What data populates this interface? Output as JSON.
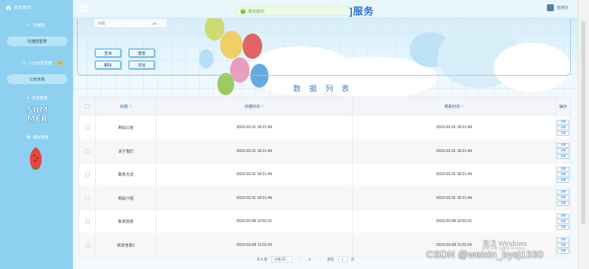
{
  "sidebar": {
    "home_label": "后台首页",
    "groups": [
      {
        "label": "轮播图",
        "sub": "轮播图管理"
      },
      {
        "label": "公告信息管理",
        "sub": "公告信息"
      },
      {
        "label": "供货管理"
      },
      {
        "label": "模块管理"
      }
    ]
  },
  "header": {
    "toast": "提交成功!",
    "title_fragment": "]服务",
    "user": "管理员"
  },
  "search_panel": {
    "tab_label": "标题",
    "buttons": {
      "query": "查询",
      "reset": "重置",
      "delete": "删除",
      "add": "添加"
    }
  },
  "section_title": "数据列表",
  "table": {
    "headers": {
      "title": "标题",
      "created": "创建时间",
      "updated": "更新时间",
      "ops": "操作"
    },
    "op_labels": {
      "edit": "详情"
    },
    "rows": [
      {
        "title": "网站公告",
        "created": "2023-03-31 18:21:49",
        "updated": "2023-03-31 18:21:49"
      },
      {
        "title": "关于我们",
        "created": "2023-03-31 18:21:49",
        "updated": "2023-03-31 18:21:49"
      },
      {
        "title": "联系方式",
        "created": "2023-03-31 18:21:49",
        "updated": "2023-03-31 18:21:49"
      },
      {
        "title": "网站介绍",
        "created": "2023-03-31 18:21:49",
        "updated": "2023-03-31 18:21:49"
      },
      {
        "title": "新发信息",
        "created": "2023-03-08 10:50:31",
        "updated": "2023-03-08 10:50:31"
      },
      {
        "title": "新发信息2",
        "created": "2023-03-08 11:02:24",
        "updated": "2023-03-08 11:02:24"
      }
    ]
  },
  "pager": {
    "total": "共 6 条",
    "page_size": "10条/页",
    "current_page": "1",
    "goto_prefix": "前往",
    "goto_value": "1",
    "goto_suffix": "页"
  },
  "watermarks": {
    "windows": "激活 Windows",
    "windows_sub": "转到\"设置\"以激活 Windows。",
    "csdn": "CSDN @weixin_bysj1330"
  },
  "colors": {
    "sidebar_bg": "#8dd0f0",
    "accent": "#2f6fd1",
    "success": "#67c23a"
  }
}
